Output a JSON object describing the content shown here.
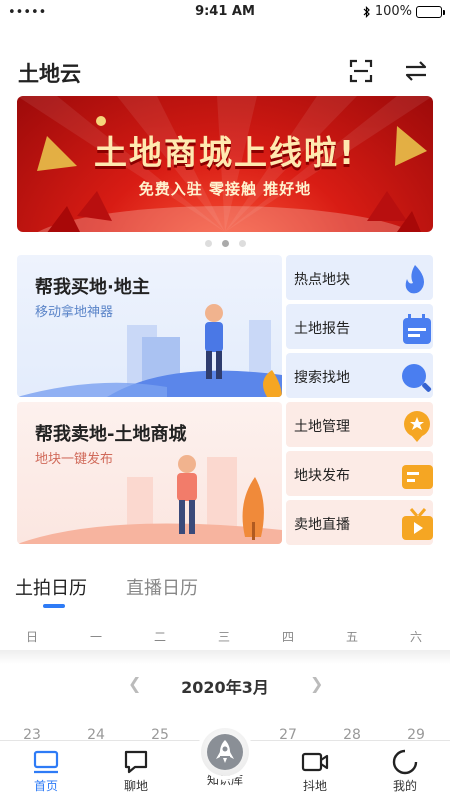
{
  "status_bar": {
    "carrier": "•••••",
    "time": "9:41 AM",
    "battery": "100%"
  },
  "header": {
    "title": "土地云",
    "scan_icon": "scan-icon",
    "switch_icon": "switch-icon"
  },
  "banner": {
    "headline": "土地商城上线啦!",
    "subtitle": "免费入驻  零接触  推好地",
    "page_count": 3,
    "active_page": 2
  },
  "buy_card": {
    "title": "帮我买地·地主",
    "subtitle": "移动拿地神器"
  },
  "sell_card": {
    "title": "帮我卖地-土地商城",
    "subtitle": "地块一键发布"
  },
  "quick_items": [
    {
      "label": "热点地块",
      "icon": "fire-icon",
      "color": "#4a7ef0"
    },
    {
      "label": "土地报告",
      "icon": "report-icon",
      "color": "#4a7ef0"
    },
    {
      "label": "搜索找地",
      "icon": "search-icon",
      "color": "#4a7ef0"
    },
    {
      "label": "土地管理",
      "icon": "medal-icon",
      "color": "#f5a623"
    },
    {
      "label": "地块发布",
      "icon": "card-icon",
      "color": "#f5a623"
    },
    {
      "label": "卖地直播",
      "icon": "tv-icon",
      "color": "#f5a623"
    }
  ],
  "calendar": {
    "tabs": [
      "土拍日历",
      "直播日历"
    ],
    "active_tab": 0,
    "weekdays": [
      "日",
      "一",
      "二",
      "三",
      "四",
      "五",
      "六"
    ],
    "month": "2020年3月",
    "days": [
      "23",
      "24",
      "25",
      "",
      "27",
      "28",
      "29"
    ]
  },
  "tab_bar": {
    "items": [
      {
        "label": "首页",
        "icon": "home-icon"
      },
      {
        "label": "聊地",
        "icon": "chat-icon"
      },
      {
        "label": "知识库",
        "icon": "rocket-icon"
      },
      {
        "label": "抖地",
        "icon": "video-icon"
      },
      {
        "label": "我的",
        "icon": "profile-icon"
      }
    ],
    "active": 0
  },
  "colors": {
    "accent": "#2e7bf6",
    "banner_red": "#d81c14"
  }
}
